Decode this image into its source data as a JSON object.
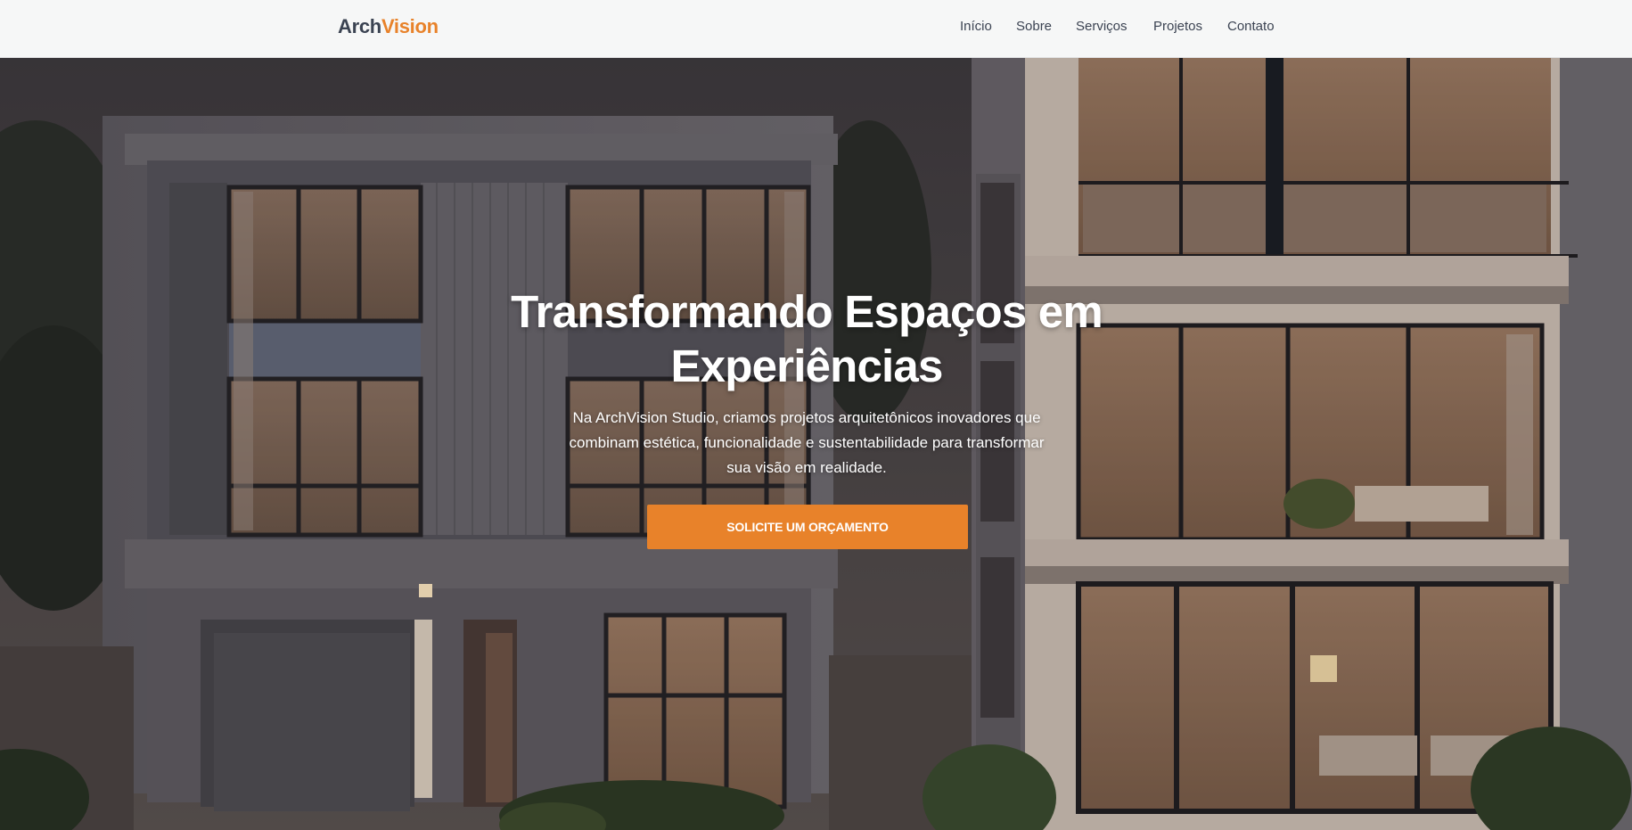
{
  "header": {
    "logo": {
      "part1": "Arch",
      "part2": "Vision"
    },
    "nav": [
      {
        "label": "Início"
      },
      {
        "label": "Sobre"
      },
      {
        "label": "Serviços"
      },
      {
        "label": "Projetos"
      },
      {
        "label": "Contato"
      }
    ]
  },
  "hero": {
    "title": "Transformando Espaços em Experiências",
    "subtitle": "Na ArchVision Studio, criamos projetos arquitetônicos inovadores que combinam estética, funcionalidade e sustentabilidade para transformar sua visão em realidade.",
    "cta_label": "SOLICITE UM ORÇAMENTO",
    "background_image": "modern-two-story-house-at-dusk"
  },
  "colors": {
    "accent": "#e8822a",
    "text_dark": "#3b4352",
    "header_bg": "#f6f7f7"
  }
}
